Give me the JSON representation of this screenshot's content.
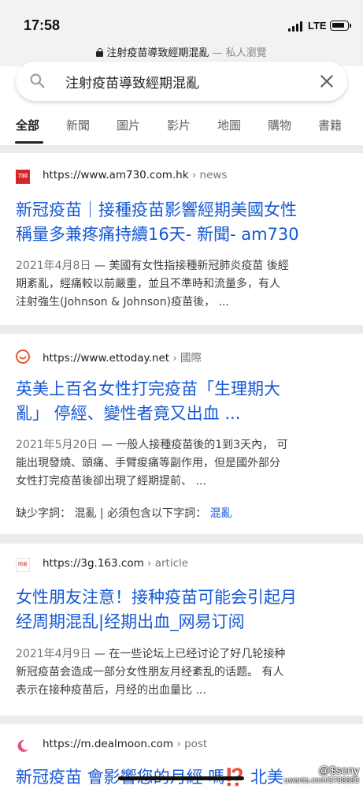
{
  "status": {
    "time": "17:58",
    "network": "LTE"
  },
  "url_bar": {
    "title": "注射疫苗導致經期混亂",
    "mode": "— 私人瀏覽"
  },
  "search": {
    "query": "注射疫苗導致經期混亂"
  },
  "tabs": [
    "全部",
    "新聞",
    "圖片",
    "影片",
    "地圖",
    "購物",
    "書籍"
  ],
  "results": [
    {
      "favicon_text": "730",
      "url": "https://www.am730.com.hk",
      "crumb": " › news",
      "title_line1": "新冠疫苗｜接種疫苗影響經期美國女性",
      "title_line2": "稱量多兼疼痛持續16天- 新聞- am730",
      "date": "2021年4月8日",
      "snippet_line1": " — 美國有女性指接種新冠肺炎疫苗 後經",
      "snippet_line2": "期紊亂，經痛較以前嚴重，並且不準時和流量多，有人",
      "snippet_line3": "注射強生(Johnson & Johnson)疫苗後，  ..."
    },
    {
      "url": "https://www.ettoday.net",
      "crumb": " › 國際",
      "title_line1": "英美上百名女性打完疫苗「生理期大",
      "title_line2": "亂」 停經、變性者竟又出血 ...",
      "date": "2021年5月20日",
      "snippet_line1": " — 一般人接種疫苗後的1到3天內， 可",
      "snippet_line2": "能出現發燒、頭痛、手臂痠痛等副作用，但是國外部分",
      "snippet_line3": "女性打完疫苗後卻出現了經期提前、 ...",
      "missing_label": "缺少字詞： 混亂 | 必須包含以下字詞：",
      "missing_link": "混亂"
    },
    {
      "favicon_text": "网易",
      "url": "https://3g.163.com",
      "crumb": " › article",
      "title_line1": "女性朋友注意！接种疫苗可能会引起月",
      "title_line2": "经周期混乱|经期出血_网易订阅",
      "date": "2021年4月9日",
      "snippet_line1": " — 在一些论坛上已经讨论了好几轮接种",
      "snippet_line2": "新冠疫苗会造成一部分女性朋友月经紊乱的话题。 有人",
      "snippet_line3": "表示在接种疫苗后，月经的出血量比 ..."
    },
    {
      "url": "https://m.dealmoon.com",
      "crumb": " › post",
      "title_line1": "新冠疫苗 會影響您的月經 嗎⁉️ 北美"
    }
  ],
  "watermark": {
    "top": "@$sony",
    "bottom": "uwants.com/3788883"
  },
  "colors": {
    "link": "#1558d6",
    "background": "#ebebeb"
  }
}
